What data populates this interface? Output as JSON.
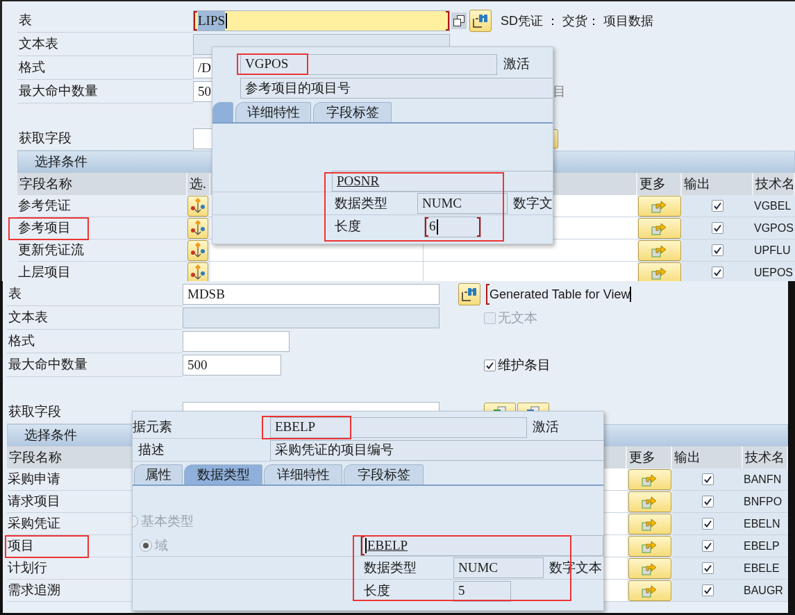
{
  "top": {
    "form": [
      {
        "label": "表",
        "value": "LIPS",
        "kind": "input",
        "focused": true
      },
      {
        "label": "文本表",
        "kind": "readonly",
        "focused": false
      },
      {
        "label": "格式",
        "value": "/D",
        "kind": "input",
        "focused": false
      },
      {
        "label": "最大命中数量",
        "value": "50",
        "kind": "input",
        "focused": false,
        "option": {
          "kind": "text",
          "label": "目"
        }
      },
      {
        "label": "获取字段",
        "kind": "input",
        "focused": false
      }
    ],
    "copy_button": true,
    "description": {
      "text": "SD凭证 ： 交货： 项目数据",
      "focused": false
    },
    "selection": {
      "title": "选择条件",
      "columns": [
        {
          "kind": "name",
          "label": "字段名称"
        },
        {
          "kind": "select",
          "label": "选."
        },
        {
          "kind": "more",
          "label": "更多"
        },
        {
          "kind": "output",
          "label": "输出"
        },
        {
          "kind": "tech",
          "label": "技术名"
        }
      ],
      "rows": [
        {
          "name": "参考凭证",
          "output": true,
          "tech": "VGBEL",
          "annotated": false
        },
        {
          "name": "参考项目",
          "output": true,
          "tech": "VGPOS",
          "annotated": true
        },
        {
          "name": "更新凭证流",
          "output": true,
          "tech": "UPFLU",
          "annotated": false
        },
        {
          "name": "上层项目",
          "output": true,
          "tech": "UEPOS",
          "annotated": false
        }
      ]
    },
    "popup": {
      "data_element": {
        "value": "VGPOS",
        "annotated": true
      },
      "status": "激活",
      "short_text": {
        "value": "参考项目的项目号"
      },
      "tabs": [
        {
          "selected": true
        },
        {
          "label": "详细特性",
          "selected": false
        },
        {
          "label": "字段标签",
          "selected": false
        }
      ],
      "domain": {
        "name": "POSNR",
        "name_focused": false,
        "type_label": "数据类型",
        "type": "NUMC",
        "type_text": "数字文",
        "length_label": "长度",
        "length": "6",
        "length_focused": true,
        "annotated": true
      }
    }
  },
  "bottom": {
    "form": [
      {
        "label": "表",
        "value": "MDSB",
        "kind": "input",
        "focused": false
      },
      {
        "label": "文本表",
        "kind": "readonly",
        "focused": false,
        "option": {
          "kind": "checkbox",
          "label": "无文本",
          "checked": false,
          "disabled": true
        }
      },
      {
        "label": "格式",
        "kind": "input",
        "focused": false
      },
      {
        "label": "最大命中数量",
        "value": "500",
        "kind": "input",
        "focused": false,
        "option": {
          "kind": "checkbox",
          "label": "维护条目",
          "checked": true,
          "disabled": false
        }
      },
      {
        "label": "获取字段",
        "kind": "input",
        "focused": false
      }
    ],
    "description": {
      "text": "Generated Table for View",
      "focused": true
    },
    "selection": {
      "title": "选择条件",
      "columns": [
        {
          "kind": "name",
          "label": "字段名称"
        },
        {
          "kind": "more",
          "label": "更多"
        },
        {
          "kind": "output",
          "label": "输出"
        },
        {
          "kind": "tech",
          "label": "技术名"
        }
      ],
      "rows": [
        {
          "name": "采购申请",
          "output": true,
          "tech": "BANFN",
          "annotated": false
        },
        {
          "name": "请求项目",
          "output": true,
          "tech": "BNFPO",
          "annotated": false
        },
        {
          "name": "采购凭证",
          "output": true,
          "tech": "EBELN",
          "annotated": false
        },
        {
          "name": "项目",
          "output": true,
          "tech": "EBELP",
          "annotated": true
        },
        {
          "name": "计划行",
          "output": true,
          "tech": "EBELE",
          "annotated": false
        },
        {
          "name": "需求追溯",
          "output": true,
          "tech": "BAUGR",
          "annotated": false
        }
      ]
    },
    "popup": {
      "data_element": {
        "label": "据元素",
        "value": "EBELP",
        "annotated": true
      },
      "status": "激活",
      "short_text": {
        "label": "描述",
        "value": "采购凭证的项目编号"
      },
      "tabs": [
        {
          "label": "属性",
          "selected": false
        },
        {
          "label": "数据类型",
          "selected": true
        },
        {
          "label": "详细特性",
          "selected": false
        },
        {
          "label": "字段标签",
          "selected": false
        }
      ],
      "radios": [
        {
          "label": "基本类型",
          "selected": false,
          "disabled": true
        },
        {
          "label": "域",
          "selected": true,
          "disabled": true
        }
      ],
      "domain": {
        "name": "EBELP",
        "name_focused": true,
        "type_label": "数据类型",
        "type": "NUMC",
        "type_text": "数字文本",
        "length_label": "长度",
        "length": "5",
        "length_focused": false,
        "annotated": true
      }
    }
  }
}
